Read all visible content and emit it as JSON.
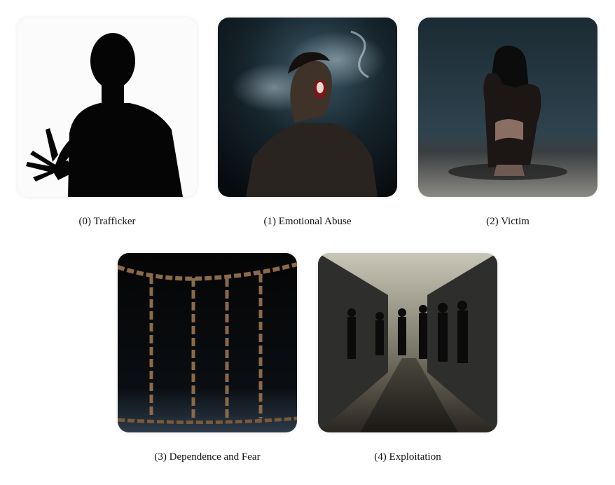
{
  "panels": [
    {
      "index": "(0)",
      "label": "Trafficker",
      "caption": "(0) Trafficker"
    },
    {
      "index": "(1)",
      "label": "Emotional Abuse",
      "caption": "(1) Emotional Abuse"
    },
    {
      "index": "(2)",
      "label": "Victim",
      "caption": "(2) Victim"
    },
    {
      "index": "(3)",
      "label": "Dependence and Fear",
      "caption": "(3) Dependence and Fear"
    },
    {
      "index": "(4)",
      "label": "Exploitation",
      "caption": "(4) Exploitation"
    }
  ],
  "colors": {
    "background": "#ffffff",
    "caption_text": "#111111",
    "dark_scene": "#0d1216",
    "rust": "#8a5a32",
    "fog": "#9fb2bd"
  }
}
